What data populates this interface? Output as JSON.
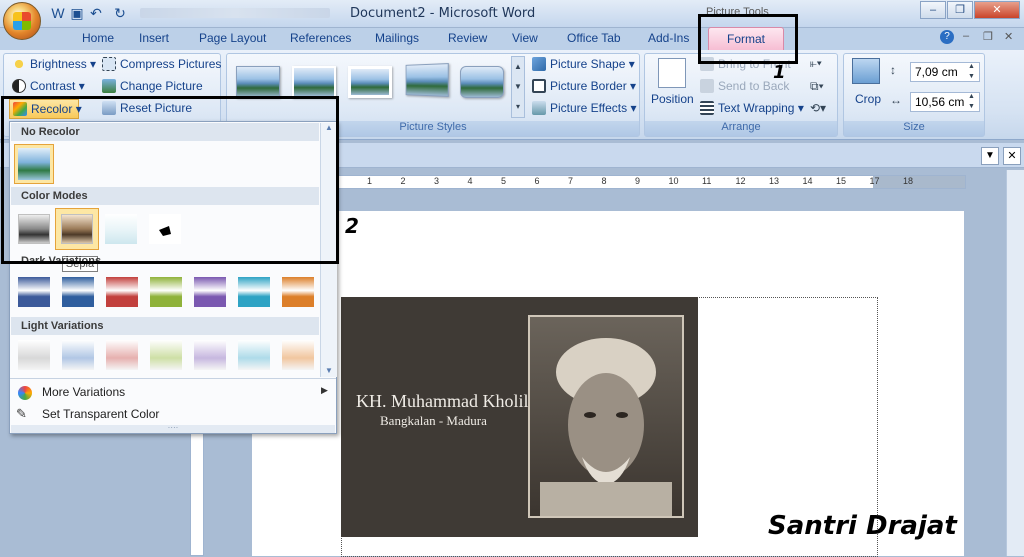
{
  "titlebar": {
    "title": "Document2 - Microsoft Word",
    "contextual_tab_group": "Picture Tools",
    "minimize": "–",
    "maximize": "❐",
    "close": "✕"
  },
  "quick_access": {
    "icons": [
      "office-button-icon",
      "word-icon",
      "save-icon",
      "undo-icon",
      "redo-icon"
    ]
  },
  "tabs": [
    "Home",
    "Insert",
    "Page Layout",
    "References",
    "Mailings",
    "Review",
    "View",
    "Office Tab",
    "Add-Ins",
    "Format"
  ],
  "active_tab": "Format",
  "ribbon": {
    "adjust": {
      "brightness": "Brightness",
      "contrast": "Contrast",
      "recolor": "Recolor",
      "compress": "Compress Pictures",
      "change": "Change Picture",
      "reset": "Reset Picture"
    },
    "picture_styles": {
      "label": "Picture Styles",
      "shape": "Picture Shape",
      "border": "Picture Border",
      "effects": "Picture Effects"
    },
    "arrange": {
      "label": "Arrange",
      "position": "Position",
      "bring_to_front": "Bring to Front",
      "send_to_back": "Send to Back",
      "text_wrapping": "Text Wrapping"
    },
    "size": {
      "label": "Size",
      "crop": "Crop",
      "height": "7,09 cm",
      "width": "10,56 cm"
    }
  },
  "recolor_panel": {
    "no_recolor": "No Recolor",
    "color_modes": "Color Modes",
    "dark_variations": "Dark Variations",
    "light_variations": "Light Variations",
    "more_variations": "More Variations",
    "set_transparent": "Set Transparent Color",
    "tooltip": "Sepia",
    "dark_colors": [
      "#3c5a9a",
      "#2f5e9e",
      "#c2403d",
      "#8fb23a",
      "#7a58b0",
      "#2ea3c4",
      "#dc7f2a"
    ],
    "light_colors": [
      "#d4d4d4",
      "#a9c1e2",
      "#e4a8a6",
      "#c9dc9c",
      "#c1b0dc",
      "#a6d8e7",
      "#f0c095"
    ]
  },
  "ruler": {
    "ticks": [
      "1",
      "2",
      "3",
      "4",
      "5",
      "6",
      "7",
      "8",
      "9",
      "10",
      "11",
      "12",
      "13",
      "14",
      "15",
      "17",
      "18"
    ]
  },
  "document": {
    "card_name": "KH. Muhammad Kholil",
    "card_subtitle": "Bangkalan - Madura",
    "watermark": "Santri Drajat"
  },
  "annotations": {
    "one": "1",
    "two": "2"
  }
}
